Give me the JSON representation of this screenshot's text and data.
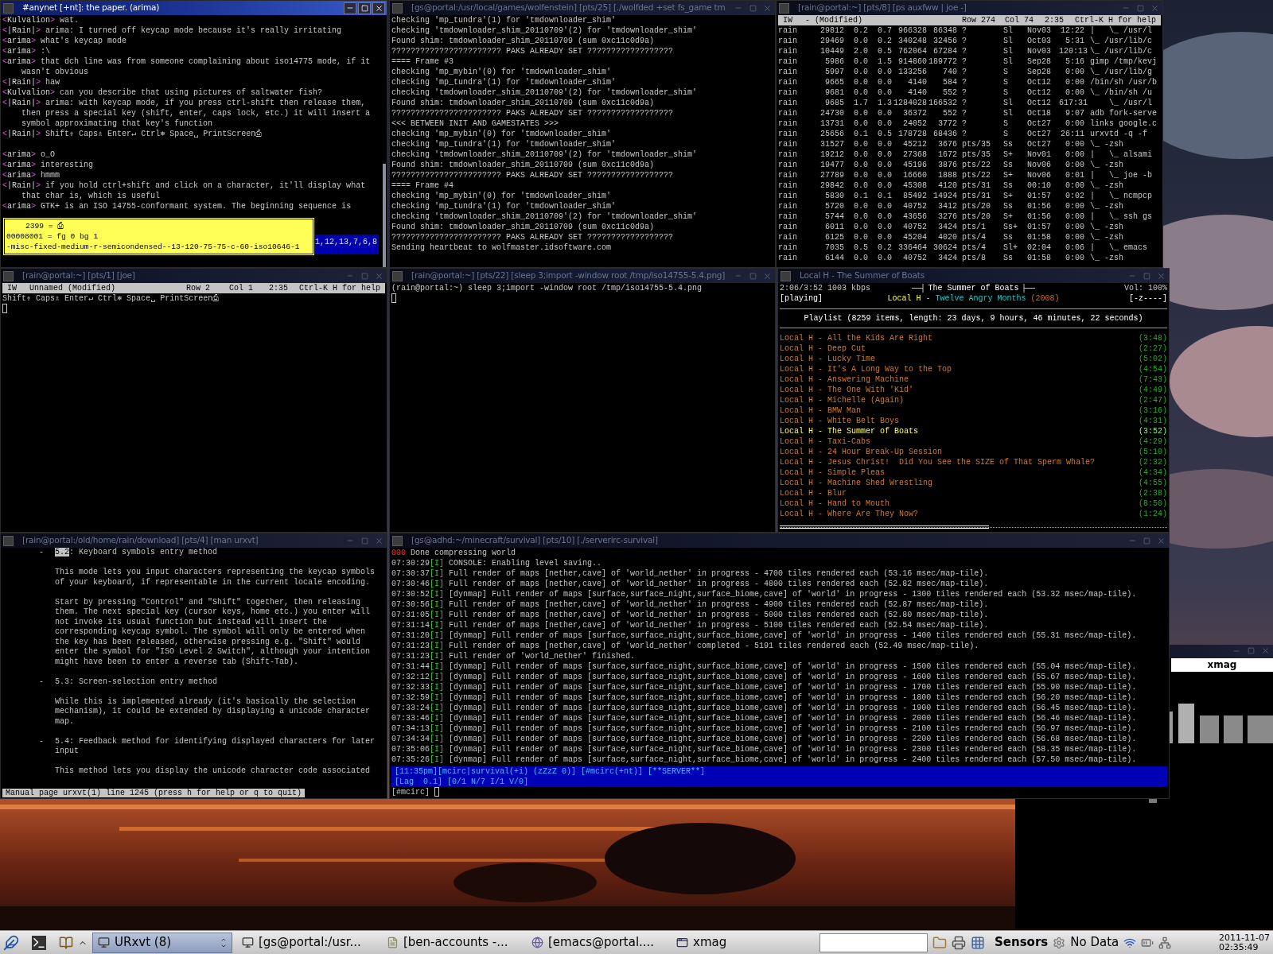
{
  "windows": [
    {
      "kind": "irc",
      "title": "#anynet [+nt]: the paper. (arima)",
      "active": true,
      "blocks": [
        [
          {
            "open": "<",
            "nick": "Kulvalion",
            "close": ">",
            "text": "wat."
          },
          {
            "open": "<",
            "nick": "|Rain|",
            "close": ">",
            "text": "arima: I turned off keycap mode because it's really irritating"
          },
          {
            "open": "<",
            "nick": "arima",
            "close": ">",
            "text": "what's keycap mode"
          },
          {
            "open": "<",
            "nick": "arima",
            "close": ">",
            "text": ":\\"
          },
          {
            "open": "<",
            "nick": "arima",
            "close": ">",
            "text": "that dch line was from someone complaining about iso14775 mode, if it wasn't obvious"
          },
          {
            "open": "<",
            "nick": "|Rain|",
            "close": ">",
            "text": "haw"
          },
          {
            "open": "<",
            "nick": "Kulvalion",
            "close": ">",
            "text": "can you describe that using pictures of saltwater fish?"
          },
          {
            "open": "<",
            "nick": "|Rain|",
            "close": ">",
            "text": "arima: with keycap mode, if you press ctrl-shift then release them, then press a special key (shift, enter, caps lock, etc.) it will insert a symbol approximating that key's function"
          },
          {
            "open": "<",
            "nick": "|Rain|",
            "close": ">",
            "text": "Shift⇮ Caps⇬ Enter↵ Ctrl⎈ Space␣ PrintScreen⎙"
          }
        ],
        [
          {
            "open": "<",
            "nick": "arima",
            "close": ">",
            "text": "o_O"
          },
          {
            "open": "<",
            "nick": "arima",
            "close": ">",
            "text": "interesting"
          },
          {
            "open": "<",
            "nick": "arima",
            "close": ">",
            "text": "hmmm"
          },
          {
            "open": "<",
            "nick": "|Rain|",
            "close": ">",
            "text": "if you hold ctrl+shift and click on a character, it'll display what that char is, which is useful"
          },
          {
            "open": "<",
            "nick": "arima",
            "close": ">",
            "text": "GTK+ is an ISO 14755-conformant system. The beginning sequence is"
          }
        ]
      ],
      "tooltip": [
        "2399 = ⎙",
        "00008001 = fg 0 bg 1",
        "-misc-fixed-medium-r-semicondensed--13-120-75-75-c-60-iso10646-1"
      ],
      "selection": "1,12,13,7,6,8"
    },
    {
      "kind": "log",
      "title": "[gs@portal:/usr/local/games/wolfenstein] [pts/25] [./wolfded +set fs_game tm",
      "active": false,
      "lines": [
        "checking 'mp_tundra'(1) for 'tmdownloader_shim'",
        "checking 'tmdownloader_shim_20110709'(2) for 'tmdownloader_shim'",
        "Found shim: tmdownloader_shim_20110709 (sum 0xc11c0d9a)",
        "??????????????????????? PAKS ALREADY SET ??????????????????",
        "==== Frame #3",
        "checking 'mp_mybin'(0) for 'tmdownloader_shim'",
        "checking 'mp_tundra'(1) for 'tmdownloader_shim'",
        "checking 'tmdownloader_shim_20110709'(2) for 'tmdownloader_shim'",
        "Found shim: tmdownloader_shim_20110709 (sum 0xc11c0d9a)",
        "??????????????????????? PAKS ALREADY SET ??????????????????",
        "<<< BETWEEN INIT AND GAMESTATES >>>",
        "checking 'mp_mybin'(0) for 'tmdownloader_shim'",
        "checking 'mp_tundra'(1) for 'tmdownloader_shim'",
        "checking 'tmdownloader_shim_20110709'(2) for 'tmdownloader_shim'",
        "Found shim: tmdownloader_shim_20110709 (sum 0xc11c0d9a)",
        "??????????????????????? PAKS ALREADY SET ??????????????????",
        "==== Frame #4",
        "checking 'mp_mybin'(0) for 'tmdownloader_shim'",
        "checking 'mp_tundra'(1) for 'tmdownloader_shim'",
        "checking 'tmdownloader_shim_20110709'(2) for 'tmdownloader_shim'",
        "Found shim: tmdownloader_shim_20110709 (sum 0xc11c0d9a)",
        "??????????????????????? PAKS ALREADY SET ??????????????????",
        "Sending heartbeat to wolfmaster.idsoftware.com"
      ]
    },
    {
      "kind": "table",
      "title": "[rain@portal:~] [pts/8] [ps auxfww | joe -]",
      "active": false,
      "status": [
        "IW",
        "- (Modified)",
        "Row 274",
        "Col 74",
        "2:35",
        "Ctrl-K H for help"
      ],
      "rows": [
        [
          "rain",
          "29812",
          "0.2",
          "0.7",
          "966328",
          "86348",
          "?",
          "Sl",
          "Nov03",
          "12:22",
          "|   \\_ /usr/l"
        ],
        [
          "rain",
          "29469",
          "0.0",
          "0.2",
          "340248",
          "32456",
          "?",
          "Sl",
          "Oct03",
          "5:31",
          "\\_ /usr/lib/c"
        ],
        [
          "rain",
          "10449",
          "2.0",
          "0.5",
          "762064",
          "67284",
          "?",
          "Sl",
          "Nov03",
          "120:13",
          "\\_ /usr/lib/c"
        ],
        [
          "rain",
          "5986",
          "0.0",
          "1.5",
          "914860",
          "189772",
          "?",
          "Sl",
          "Sep28",
          "5:16",
          "gimp /tmp/kevj"
        ],
        [
          "rain",
          "5997",
          "0.0",
          "0.0",
          "133256",
          "740",
          "?",
          "S",
          "Sep28",
          "0:00",
          "\\_ /usr/lib/g"
        ],
        [
          "rain",
          "9665",
          "0.0",
          "0.0",
          "4140",
          "584",
          "?",
          "S",
          "Oct12",
          "0:00",
          "/bin/sh /usr/b"
        ],
        [
          "rain",
          "9681",
          "0.0",
          "0.0",
          "4140",
          "552",
          "?",
          "S",
          "Oct12",
          "0:00",
          "\\_ /bin/sh /u"
        ],
        [
          "rain",
          "9685",
          "1.7",
          "1.3",
          "1284028",
          "166532",
          "?",
          "Sl",
          "Oct12",
          "617:31",
          "    \\_ /usr/l"
        ],
        [
          "rain",
          "24730",
          "0.0",
          "0.0",
          "36372",
          "552",
          "?",
          "Sl",
          "Oct18",
          "9:07",
          "adb fork-serve"
        ],
        [
          "rain",
          "13731",
          "0.0",
          "0.0",
          "24052",
          "3772",
          "?",
          "S",
          "Oct27",
          "0:00",
          "links google.c"
        ],
        [
          "rain",
          "25656",
          "0.1",
          "0.5",
          "178728",
          "68436",
          "?",
          "S",
          "Oct27",
          "26:11",
          "urxvtd -q -f"
        ],
        [
          "rain",
          "31527",
          "0.0",
          "0.0",
          "45212",
          "3676",
          "pts/35",
          "Ss",
          "Oct27",
          "0:00",
          "\\_ -zsh"
        ],
        [
          "rain",
          "19212",
          "0.0",
          "0.0",
          "27368",
          "1672",
          "pts/35",
          "S+",
          "Nov01",
          "0:00",
          "|   \\_ alsami"
        ],
        [
          "rain",
          "19477",
          "0.0",
          "0.0",
          "45196",
          "3876",
          "pts/22",
          "Ss",
          "Nov06",
          "0:00",
          "\\_ -zsh"
        ],
        [
          "rain",
          "27789",
          "0.0",
          "0.0",
          "16660",
          "1888",
          "pts/22",
          "S+",
          "Nov06",
          "0:01",
          "|   \\_ joe -b"
        ],
        [
          "rain",
          "29842",
          "0.0",
          "0.0",
          "45308",
          "4120",
          "pts/31",
          "Ss",
          "00:10",
          "0:00",
          "\\_ -zsh"
        ],
        [
          "rain",
          "5830",
          "0.1",
          "0.1",
          "85492",
          "14924",
          "pts/31",
          "S+",
          "01:57",
          "0:02",
          "|   \\_ ncmpcp"
        ],
        [
          "rain",
          "5720",
          "0.0",
          "0.0",
          "40752",
          "3412",
          "pts/20",
          "Ss",
          "01:56",
          "0:00",
          "\\_ -zsh"
        ],
        [
          "rain",
          "5744",
          "0.0",
          "0.0",
          "43656",
          "3276",
          "pts/20",
          "S+",
          "01:56",
          "0:00",
          "|   \\_ ssh gs"
        ],
        [
          "rain",
          "6011",
          "0.0",
          "0.0",
          "40752",
          "3424",
          "pts/1",
          "Ss+",
          "01:57",
          "0:00",
          "\\_ -zsh"
        ],
        [
          "rain",
          "6125",
          "0.0",
          "0.0",
          "45204",
          "4020",
          "pts/4",
          "Ss",
          "01:58",
          "0:00",
          "\\_ -zsh"
        ],
        [
          "rain",
          "7035",
          "0.5",
          "0.2",
          "336464",
          "30624",
          "pts/4",
          "Sl+",
          "02:04",
          "0:06",
          "|   \\_ emacs"
        ],
        [
          "rain",
          "6144",
          "0.0",
          "0.0",
          "40752",
          "3424",
          "pts/8",
          "Ss",
          "01:58",
          "0:00",
          "\\_ -zsh"
        ]
      ]
    },
    {
      "kind": "editor",
      "title": "[rain@portal:~] [pts/1] [joe]",
      "active": false,
      "status": [
        "IW",
        "Unnamed (Modified)",
        "Row 2",
        "Col 1",
        "2:35",
        "Ctrl-K H for help"
      ],
      "lines": [
        "Shift⇮ Caps⇬ Enter↵ Ctrl⎈ Space␣ PrintScreen⎙"
      ]
    },
    {
      "kind": "shell",
      "title": "[rain@portal:~] [pts/22] [sleep 3;import -window root /tmp/iso14755-5.4.png]",
      "active": false,
      "prompt": "(rain@portal:~)",
      "command": "sleep 3;import -window root /tmp/iso14755-5.4.png"
    },
    {
      "kind": "player",
      "title": "Local H - The Summer of Boats",
      "active": false,
      "time": "2:06/3:52 1003 kbps",
      "song": "The Summer of Boats",
      "volume": "Vol: 100%",
      "state": "[playing]",
      "artist": "Local H",
      "separator": "-",
      "album": "Twelve Angry Months",
      "year": "(2008)",
      "flags": "[-z----]",
      "playlist_header": "Playlist (8259 items, length: 23 days, 9 hours, 46 minutes, 22 seconds)",
      "level": 0.54,
      "items": [
        {
          "title": "Local H - All the Kids Are Right",
          "duration": "(3:48)",
          "selected": false
        },
        {
          "title": "Local H - Deep Cut",
          "duration": "(2:27)",
          "selected": false
        },
        {
          "title": "Local H - Lucky Time",
          "duration": "(5:02)",
          "selected": false
        },
        {
          "title": "Local H - It's A Long Way to the Top",
          "duration": "(4:54)",
          "selected": false
        },
        {
          "title": "Local H - Answering Machine",
          "duration": "(7:43)",
          "selected": false
        },
        {
          "title": "Local H - The One With 'Kid'",
          "duration": "(4:49)",
          "selected": false
        },
        {
          "title": "Local H - Michelle (Again)",
          "duration": "(2:47)",
          "selected": false
        },
        {
          "title": "Local H - BMW Man",
          "duration": "(3:16)",
          "selected": false
        },
        {
          "title": "Local H - White Belt Boys",
          "duration": "(4:31)",
          "selected": false
        },
        {
          "title": "Local H - The Summer of Boats",
          "duration": "(3:52)",
          "selected": true
        },
        {
          "title": "Local H - Taxi-Cabs",
          "duration": "(4:29)",
          "selected": false
        },
        {
          "title": "Local H - 24 Hour Break-Up Session",
          "duration": "(5:10)",
          "selected": false
        },
        {
          "title": "Local H - Jesus Christ!  Did You See the SIZE of That Sperm Whale?",
          "duration": "(2:32)",
          "selected": false
        },
        {
          "title": "Local H - Simple Pleas",
          "duration": "(4:34)",
          "selected": false
        },
        {
          "title": "Local H - Machine Shed Wrestling",
          "duration": "(4:55)",
          "selected": false
        },
        {
          "title": "Local H - Blur",
          "duration": "(2:38)",
          "selected": false
        },
        {
          "title": "Local H - Hand to Mouth",
          "duration": "(8:50)",
          "selected": false
        },
        {
          "title": "Local H - Where Are They Now?",
          "duration": "(1:24)",
          "selected": false
        }
      ]
    },
    {
      "kind": "manpage",
      "title": "[rain@portal:/old/home/rain/download] [pts/4] [man urxvt]",
      "active": false,
      "paragraphs": [
        {
          "bullet": "-",
          "highlight": "5.2",
          "lines": [
            ": Keyboard symbols entry method"
          ]
        },
        {
          "lines": [
            "This mode lets you input characters representing the keycap symbols",
            "of your keyboard, if representable in the current locale encoding."
          ]
        },
        {
          "lines": [
            "Start by pressing \"Control\" and \"Shift\" together, then releasing",
            "them. The next special key (cursor keys, home etc.) you enter will",
            "not invoke its usual function but instead will insert the",
            "corresponding keycap symbol. The symbol will only be entered when",
            "the key has been released, otherwise pressing e.g. \"Shift\" would",
            "enter the symbol for \"ISO Level 2 Switch\", although your intention",
            "might have been to enter a reverse tab (Shift-Tab)."
          ]
        },
        {
          "bullet": "-",
          "lines": [
            "5.3: Screen-selection entry method"
          ]
        },
        {
          "lines": [
            "While this is implemented already (it's basically the selection",
            "mechanism), it could be extended by displaying a unicode character",
            "map."
          ]
        },
        {
          "bullet": "-",
          "lines": [
            "5.4: Feedback method for identifying displayed characters for later",
            "input"
          ]
        },
        {
          "lines": [
            "This method lets you display the unicode character code associated"
          ]
        }
      ],
      "status": "Manual page urxvt(1) line 1245 (press h for help or q to quit)"
    },
    {
      "kind": "server",
      "title": "[gs@adhd:~/minecraft/survival] [pts/10] [./serverirc-survival]",
      "active": false,
      "lines": [
        {
          "kind": "notice",
          "badge": "000",
          "text": "Done compressing world"
        },
        {
          "kind": "log",
          "time": "07:30:29",
          "level": "[I]",
          "text": "CONSOLE: Enabling level saving.."
        },
        {
          "kind": "log",
          "time": "07:30:37",
          "level": "[I]",
          "text": "Full render of maps [nether,cave] of 'world_nether' in progress - 4700 tiles rendered each (53.16 msec/map-tile)."
        },
        {
          "kind": "log",
          "time": "07:30:46",
          "level": "[I]",
          "text": "Full render of maps [nether,cave] of 'world_nether' in progress - 4800 tiles rendered each (52.82 msec/map-tile)."
        },
        {
          "kind": "log",
          "time": "07:30:52",
          "level": "[I]",
          "text": "[dynmap] Full render of maps [surface,surface_night,surface_biome,cave] of 'world' in progress - 1300 tiles rendered each (53.32 msec/map-tile)."
        },
        {
          "kind": "log",
          "time": "07:30:56",
          "level": "[I]",
          "text": "Full render of maps [nether,cave] of 'world_nether' in progress - 4900 tiles rendered each (52.87 msec/map-tile)."
        },
        {
          "kind": "log",
          "time": "07:31:05",
          "level": "[I]",
          "text": "Full render of maps [nether,cave] of 'world_nether' in progress - 5000 tiles rendered each (52.80 msec/map-tile)."
        },
        {
          "kind": "log",
          "time": "07:31:14",
          "level": "[I]",
          "text": "Full render of maps [nether,cave] of 'world_nether' in progress - 5100 tiles rendered each (52.54 msec/map-tile)."
        },
        {
          "kind": "log",
          "time": "07:31:20",
          "level": "[I]",
          "text": "[dynmap] Full render of maps [surface,surface_night,surface_biome,cave] of 'world' in progress - 1400 tiles rendered each (55.31 msec/map-tile)."
        },
        {
          "kind": "log",
          "time": "07:31:23",
          "level": "[I]",
          "text": "Full render of maps [nether,cave] of 'world_nether' completed - 5191 tiles rendered each (52.49 msec/map-tile)."
        },
        {
          "kind": "log",
          "time": "07:31:23",
          "level": "[I]",
          "text": "Full render of 'world_nether' finished."
        },
        {
          "kind": "log",
          "time": "07:31:44",
          "level": "[I]",
          "text": "[dynmap] Full render of maps [surface,surface_night,surface_biome,cave] of 'world' in progress - 1500 tiles rendered each (55.04 msec/map-tile)."
        },
        {
          "kind": "log",
          "time": "07:32:12",
          "level": "[I]",
          "text": "[dynmap] Full render of maps [surface,surface_night,surface_biome,cave] of 'world' in progress - 1600 tiles rendered each (55.67 msec/map-tile)."
        },
        {
          "kind": "log",
          "time": "07:32:33",
          "level": "[I]",
          "text": "[dynmap] Full render of maps [surface,surface_night,surface_biome,cave] of 'world' in progress - 1700 tiles rendered each (55.90 msec/map-tile)."
        },
        {
          "kind": "log",
          "time": "07:32:59",
          "level": "[I]",
          "text": "[dynmap] Full render of maps [surface,surface_night,surface_biome,cave] of 'world' in progress - 1800 tiles rendered each (56.20 msec/map-tile)."
        },
        {
          "kind": "log",
          "time": "07:33:24",
          "level": "[I]",
          "text": "[dynmap] Full render of maps [surface,surface_night,surface_biome,cave] of 'world' in progress - 1900 tiles rendered each (56.45 msec/map-tile)."
        },
        {
          "kind": "log",
          "time": "07:33:46",
          "level": "[I]",
          "text": "[dynmap] Full render of maps [surface,surface_night,surface_biome,cave] of 'world' in progress - 2000 tiles rendered each (56.46 msec/map-tile)."
        },
        {
          "kind": "log",
          "time": "07:34:13",
          "level": "[I]",
          "text": "[dynmap] Full render of maps [surface,surface_night,surface_biome,cave] of 'world' in progress - 2100 tiles rendered each (56.97 msec/map-tile)."
        },
        {
          "kind": "log",
          "time": "07:34:34",
          "level": "[I]",
          "text": "[dynmap] Full render of maps [surface,surface_night,surface_biome,cave] of 'world' in progress - 2200 tiles rendered each (56.68 msec/map-tile)."
        },
        {
          "kind": "log",
          "time": "07:35:06",
          "level": "[I]",
          "text": "[dynmap] Full render of maps [surface,surface_night,surface_biome,cave] of 'world' in progress - 2300 tiles rendered each (58.35 msec/map-tile)."
        },
        {
          "kind": "log",
          "time": "07:35:26",
          "level": "[I]",
          "text": "[dynmap] Full render of maps [surface,surface_night,surface_biome,cave] of 'world' in progress - 2400 tiles rendered each (57.50 msec/map-tile)."
        }
      ],
      "status_lines": [
        "[11:35pm][mcirc|survival(+i) (zZzZ 0)] [#mcirc(+nt)] [**SERVER**]",
        "[Lag  0.1] [0/1 N/7 I/1 V/0]"
      ],
      "input_prompt": "[#mcirc]"
    }
  ],
  "xmag": {
    "label": "xmag"
  },
  "taskbar": {
    "tasks": [
      {
        "label": "URxvt (8)",
        "kind": "terminal",
        "selected": true
      },
      {
        "label": "[gs@portal:/usr...",
        "kind": "terminal",
        "selected": false
      },
      {
        "label": "[ben-accounts -...",
        "kind": "document",
        "selected": false
      },
      {
        "label": "[emacs@portal....",
        "kind": "editor",
        "selected": false
      },
      {
        "label": "xmag",
        "kind": "window",
        "selected": false
      }
    ],
    "sensors": "Sensors",
    "sensor_value": "No Data",
    "date": "2011-11-07",
    "time": "02:35:49"
  }
}
